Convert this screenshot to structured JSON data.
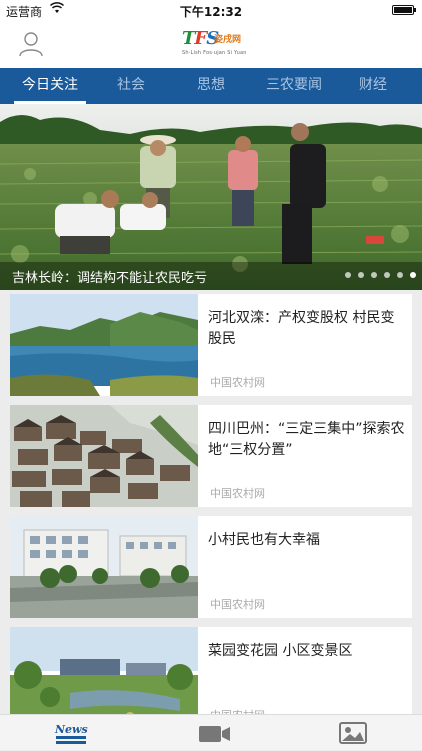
{
  "status_bar": {
    "carrier": "运营商",
    "time": "下午12:32"
  },
  "header": {
    "logo_cn": "姿戌网",
    "logo_en": "Sh·Lish Fos·ujan Si Yuan"
  },
  "tabs": [
    {
      "label": "今日关注",
      "active": true
    },
    {
      "label": "社会",
      "active": false
    },
    {
      "label": "思想",
      "active": false
    },
    {
      "label": "三农要闻",
      "active": false
    },
    {
      "label": "财经",
      "active": false
    }
  ],
  "banner": {
    "caption": "吉林长岭：调结构不能让农民吃亏",
    "slide_count": 6,
    "active_slide": 6
  },
  "news": [
    {
      "title": "河北双滦：产权变股权 村民变股民",
      "source": "中国农村网"
    },
    {
      "title": "四川巴州：“三定三集中”探索农地“三权分置”",
      "source": "中国农村网"
    },
    {
      "title": "小村民也有大幸福",
      "source": "中国农村网"
    },
    {
      "title": "菜园变花园 小区变景区",
      "source": "中国农村网"
    }
  ],
  "tabbar": {
    "news_label": "News"
  },
  "colors": {
    "nav_blue": "#1a5a9a",
    "background": "#ececec"
  }
}
